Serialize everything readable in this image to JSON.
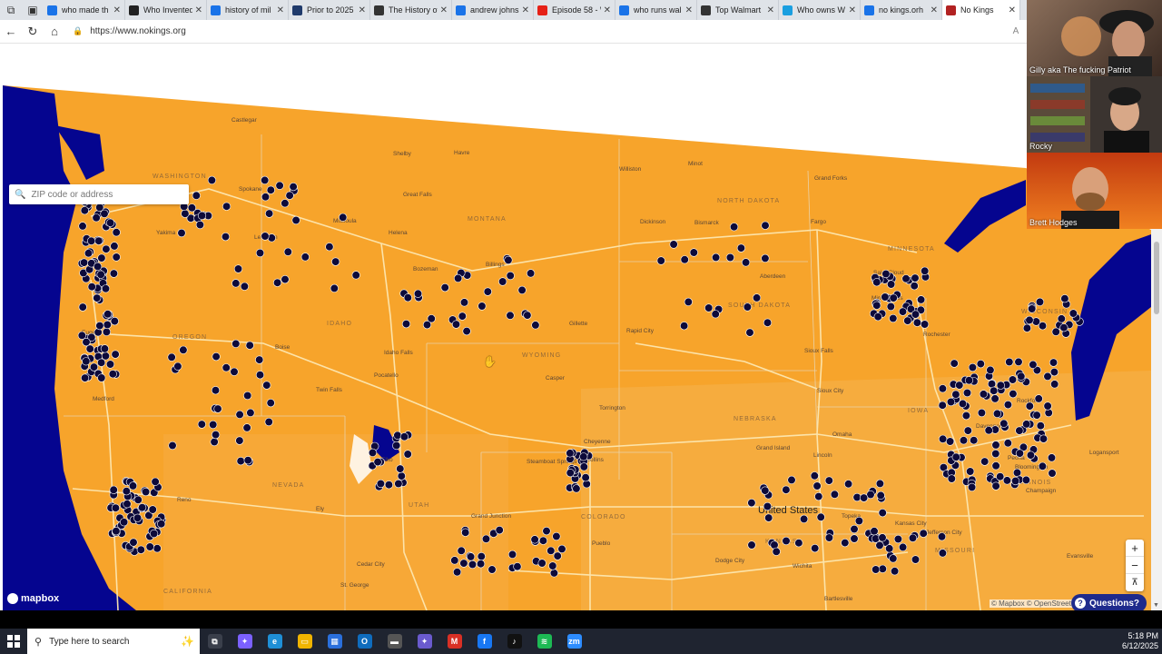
{
  "tabs": [
    {
      "title": "who made th",
      "icon": "search-icon",
      "color": "#1a73e8"
    },
    {
      "title": "Who Invented",
      "icon": "history-h-icon",
      "color": "#222222"
    },
    {
      "title": "history of mil",
      "icon": "search-icon",
      "color": "#1a73e8"
    },
    {
      "title": "Prior to 2025",
      "icon": "article-icon",
      "color": "#1f3a6b"
    },
    {
      "title": "The History of",
      "icon": "article-icon",
      "color": "#333333"
    },
    {
      "title": "andrew johns",
      "icon": "search-icon",
      "color": "#1a73e8"
    },
    {
      "title": "Episode 58 - \\",
      "icon": "youtube-icon",
      "color": "#e62117"
    },
    {
      "title": "who runs wal",
      "icon": "search-icon",
      "color": "#1a73e8"
    },
    {
      "title": "Top Walmart",
      "icon": "chatgpt-icon",
      "color": "#333333"
    },
    {
      "title": "Who owns W",
      "icon": "copilot-icon",
      "color": "#1a9fe0"
    },
    {
      "title": "no kings.orh",
      "icon": "search-icon",
      "color": "#1a73e8"
    },
    {
      "title": "No Kings",
      "icon": "nokings-icon",
      "color": "#b22222",
      "active": true
    }
  ],
  "address": {
    "url": "https://www.nokings.org"
  },
  "map": {
    "search_placeholder": "ZIP code or address",
    "logo": "mapbox",
    "attribution": "© Mapbox © OpenStreetMap",
    "questions_label": "Questions?",
    "zoom_in": "+",
    "zoom_out": "−",
    "reset": "⊼",
    "labels": {
      "washington": "WASHINGTON",
      "montana": "MONTANA",
      "north_dakota": "NORTH DAKOTA",
      "south_dakota": "SOUTH DAKOTA",
      "minnesota": "MINNESOTA",
      "idaho": "IDAHO",
      "oregon": "OREGON",
      "wyoming": "WYOMING",
      "nebraska": "NEBRASKA",
      "iowa": "IOWA",
      "nevada": "NEVADA",
      "utah": "UTAH",
      "colorado": "COLORADO",
      "kansas": "KANSAS",
      "california": "CALIFORNIA",
      "illinois": "ILLINOIS",
      "missouri": "MISSOURI",
      "wisconsin": "WISCONSIN",
      "united_states": "United States",
      "cities": [
        "Castlegar",
        "Shelby",
        "Havre",
        "Williston",
        "Minot",
        "Grand Forks",
        "Spokane",
        "Great Falls",
        "Missoula",
        "Helena",
        "Bismarck",
        "Dickinson",
        "Fargo",
        "Yakima",
        "Lewiston",
        "Bozeman",
        "Billings",
        "Aberdeen",
        "Saint Cloud",
        "Minneapolis",
        "Gillette",
        "Rapid City",
        "Rochester",
        "Eugene",
        "Boise",
        "Idaho Falls",
        "Sioux Falls",
        "Casper",
        "Twin Falls",
        "Pocatello",
        "Sioux City",
        "Medford",
        "Torrington",
        "Omaha",
        "Davenport",
        "Rockford",
        "Cheyenne",
        "Grand Island",
        "Lincoln",
        "Elko",
        "Steamboat Springs",
        "Fort Collins",
        "Peoria",
        "Reno",
        "Ely",
        "Grand Junction",
        "Bloomington",
        "Champaign",
        "Cedar City",
        "Pueblo",
        "Dodge City",
        "Topeka",
        "Kansas City",
        "Jefferson City",
        "Evansville",
        "Wichita",
        "St. George",
        "Bartlesville",
        "Logansport"
      ]
    }
  },
  "video_call": {
    "participants": [
      {
        "name": "Gilly aka The fucking  Patriot"
      },
      {
        "name": "Rocky"
      },
      {
        "name": "Brett Hodges"
      }
    ]
  },
  "taskbar": {
    "search_placeholder": "Type here to search",
    "apps": [
      {
        "name": "task-view-icon",
        "color": "#3a3f4b",
        "glyph": "⧉"
      },
      {
        "name": "copilot-app-icon",
        "color": "#7b61ff",
        "glyph": "✦"
      },
      {
        "name": "edge-icon",
        "color": "#1f8fd6",
        "glyph": "e"
      },
      {
        "name": "file-explorer-icon",
        "color": "#f0b400",
        "glyph": "▭"
      },
      {
        "name": "store-icon",
        "color": "#2a6fdb",
        "glyph": "▦"
      },
      {
        "name": "outlook-icon",
        "color": "#0f6cbd",
        "glyph": "O"
      },
      {
        "name": "app-icon",
        "color": "#555555",
        "glyph": "▬"
      },
      {
        "name": "copilot-365-icon",
        "color": "#6a5acd",
        "glyph": "✦"
      },
      {
        "name": "gmail-icon",
        "color": "#d93025",
        "glyph": "M"
      },
      {
        "name": "facebook-icon",
        "color": "#1877f2",
        "glyph": "f"
      },
      {
        "name": "tiktok-icon",
        "color": "#111111",
        "glyph": "♪"
      },
      {
        "name": "spotify-icon",
        "color": "#1db954",
        "glyph": "≋"
      },
      {
        "name": "zoom-icon",
        "color": "#2d8cff",
        "glyph": "zm"
      }
    ],
    "time": "5:18 PM",
    "date": "6/12/2025"
  },
  "colors": {
    "land": "#f7a42b",
    "water": "#05058f",
    "dot": "#0d0a3a",
    "road": "#fde7b0"
  }
}
